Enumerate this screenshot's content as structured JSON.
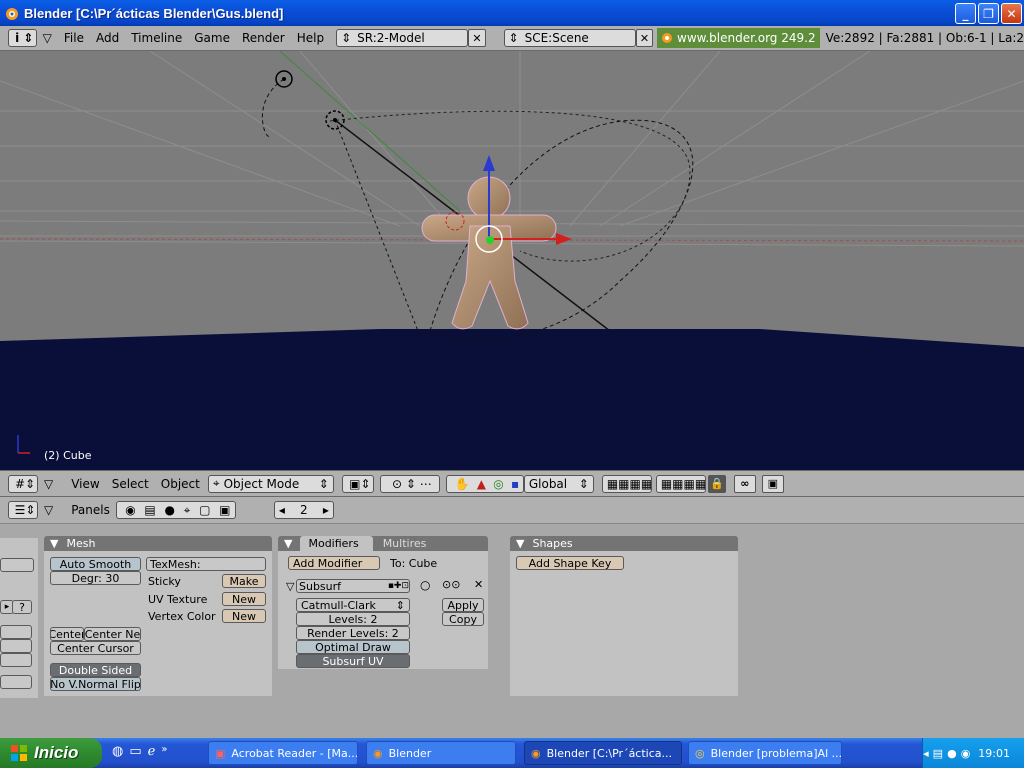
{
  "window": {
    "title": "Blender [C:\\Pr´ácticas Blender\\Gus.blend]"
  },
  "topbar": {
    "menus": [
      "File",
      "Add",
      "Timeline",
      "Game",
      "Render",
      "Help"
    ],
    "screen": "SR:2-Model",
    "scene": "SCE:Scene",
    "site": "www.blender.org 249.2",
    "stats": "Ve:2892 | Fa:2881 | Ob:6-1 | La:2"
  },
  "viewport": {
    "object_label": "(2) Cube"
  },
  "vpheader": {
    "menus": [
      "View",
      "Select",
      "Object"
    ],
    "mode": "Object Mode",
    "orientation": "Global"
  },
  "btnheader": {
    "panels_label": "Panels",
    "frame": "2"
  },
  "mesh_panel": {
    "title": "Mesh",
    "auto_smooth": "Auto Smooth",
    "degr": "Degr: 30",
    "texmesh": "TexMesh:",
    "sticky": "Sticky",
    "make": "Make",
    "uv_texture": "UV Texture",
    "new1": "New",
    "vertex_color": "Vertex Color",
    "new2": "New",
    "center": "Center",
    "center_new": "Center Ne",
    "center_cursor": "Center Cursor",
    "double_sided": "Double Sided",
    "no_vnormal_flip": "No V.Normal Flip",
    "question": "?"
  },
  "modifiers_panel": {
    "tab1": "Modifiers",
    "tab2": "Multires",
    "add_modifier": "Add Modifier",
    "to": "To: Cube",
    "modifier_name": "Subsurf",
    "subdiv_type": "Catmull-Clark",
    "levels": "Levels: 2",
    "render_levels": "Render Levels: 2",
    "optimal_draw": "Optimal Draw",
    "subsurf_uv": "Subsurf UV",
    "apply": "Apply",
    "copy": "Copy"
  },
  "shapes_panel": {
    "title": "Shapes",
    "add_shape_key": "Add Shape Key"
  },
  "taskbar": {
    "start": "Inicio",
    "tasks": [
      "Acrobat Reader - [Ma...",
      "Blender",
      "Blender [C:\\Pr´áctica...",
      "Blender [problema]Al ..."
    ],
    "clock": "19:01"
  }
}
